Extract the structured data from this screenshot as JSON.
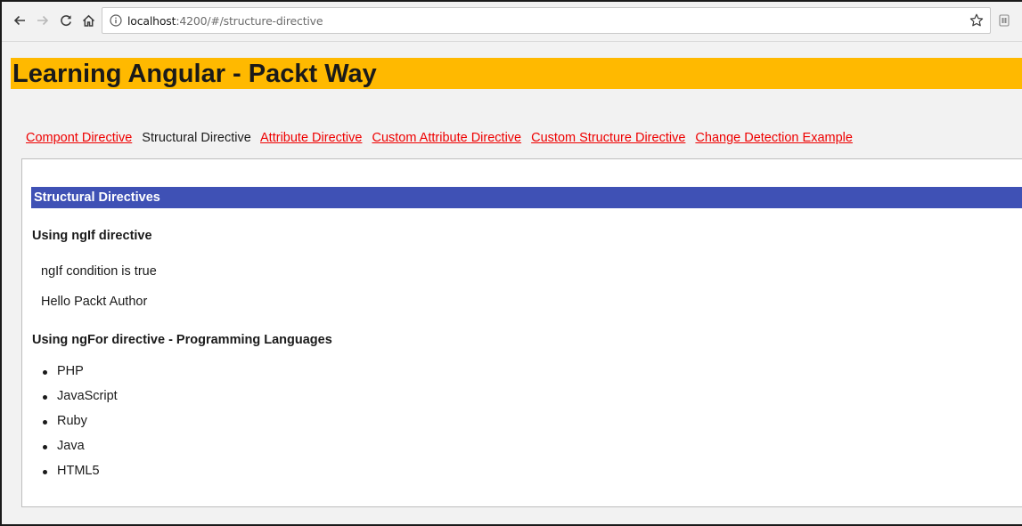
{
  "browser": {
    "url_host": "localhost",
    "url_rest": ":4200/#/structure-directive",
    "icons": {
      "back": "arrow-left-icon",
      "forward": "arrow-right-icon",
      "reload": "reload-icon",
      "home": "home-icon",
      "info": "info-icon",
      "bookmark": "star-icon",
      "extension": "extension-icon"
    }
  },
  "app": {
    "title": "Learning Angular - Packt Way",
    "header_color": "#ffb900"
  },
  "nav": {
    "links": [
      {
        "label": "Compont Directive",
        "active": false
      },
      {
        "label": "Structural Directive",
        "active": true
      },
      {
        "label": "Attribute Directive",
        "active": false
      },
      {
        "label": "Custom Attribute Directive",
        "active": false
      },
      {
        "label": "Custom Structure Directive",
        "active": false
      },
      {
        "label": "Change Detection Example",
        "active": false
      }
    ],
    "link_color": "#ee0000"
  },
  "main": {
    "section_title": "Structural Directives",
    "section_color": "#3f51b5",
    "ngif_heading": "Using ngIf directive",
    "ngif_lines": [
      "ngIf condition is true",
      "Hello Packt Author"
    ],
    "ngfor_heading": "Using ngFor directive - Programming Languages",
    "languages": [
      "PHP",
      "JavaScript",
      "Ruby",
      "Java",
      "HTML5"
    ]
  }
}
